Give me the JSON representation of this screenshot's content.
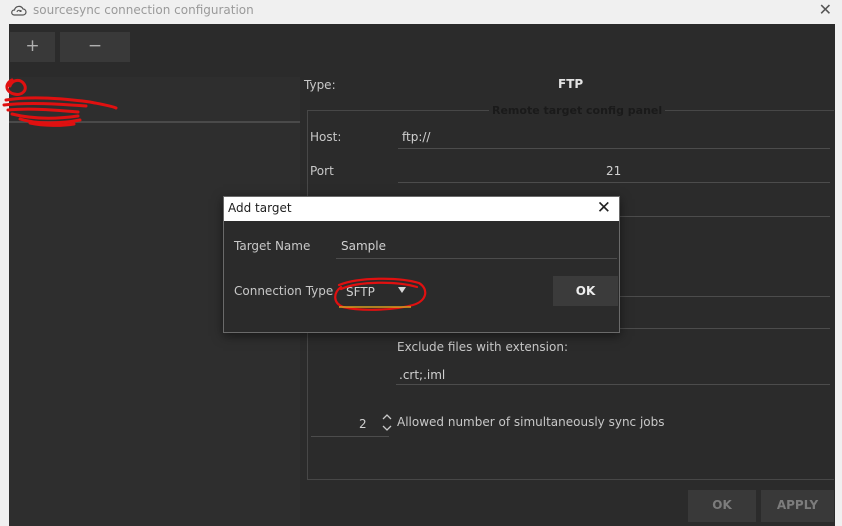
{
  "window": {
    "title": "sourcesync connection configuration",
    "close_glyph": "✕"
  },
  "toolbar": {
    "add_label": "+",
    "remove_label": "−"
  },
  "main": {
    "type_label": "Type:",
    "type_value": "FTP",
    "panel_legend": "Remote target config panel",
    "host_label": "Host:",
    "host_value": "ftp://",
    "port_label": "Port",
    "port_value": "21",
    "exclude_label": "Exclude files with extension:",
    "exclude_value": ".crt;.iml",
    "jobs_value": "2",
    "jobs_label": "Allowed number of simultaneously sync jobs"
  },
  "footer": {
    "ok_label": "OK",
    "apply_label": "APPLY"
  },
  "dialog": {
    "title": "Add target",
    "close_glyph": "✕",
    "target_name_label": "Target Name",
    "target_name_value": "Sample",
    "connection_type_label": "Connection Type",
    "connection_type_value": "SFTP",
    "ok_label": "OK"
  },
  "icons": {
    "app": "cloud-sync-icon",
    "dropdown": "triangle-down-icon",
    "spinner": "chevron-up-down-icon"
  },
  "colors": {
    "background": "#2b2b2b",
    "annotation": "#e01010",
    "dialog_title_bar": "#ffffff"
  }
}
